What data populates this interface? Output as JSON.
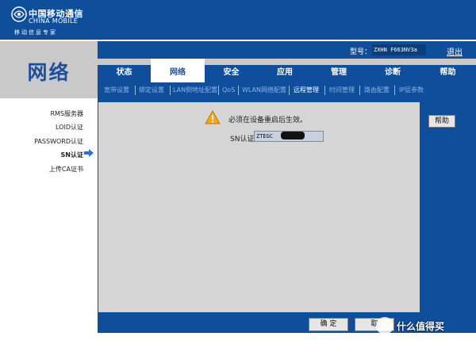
{
  "header": {
    "logo_cn": "中国移动通信",
    "logo_en": "CHINA MOBILE",
    "slogan": "移动信息专家"
  },
  "section_title": "网络",
  "model": {
    "label": "型号：",
    "value": "ZXHN F663NV3a"
  },
  "logout_label": "退出",
  "tabs": [
    {
      "label": "状态",
      "active": false
    },
    {
      "label": "网络",
      "active": true
    },
    {
      "label": "安全",
      "active": false
    },
    {
      "label": "应用",
      "active": false
    },
    {
      "label": "管理",
      "active": false
    },
    {
      "label": "诊断",
      "active": false
    },
    {
      "label": "帮助",
      "active": false
    }
  ],
  "subnav": [
    {
      "label": "宽带设置",
      "active": false
    },
    {
      "label": "绑定设置",
      "active": false
    },
    {
      "label": "LAN侧地址配置",
      "active": false
    },
    {
      "label": "QoS",
      "active": false
    },
    {
      "label": "WLAN网络配置",
      "active": false
    },
    {
      "label": "远程管理",
      "active": true
    },
    {
      "label": "时间管理",
      "active": false
    },
    {
      "label": "路由配置",
      "active": false
    },
    {
      "label": "IP层参数",
      "active": false
    }
  ],
  "leftmenu": [
    {
      "label": "RMS服务器",
      "active": false
    },
    {
      "label": "LOID认证",
      "active": false
    },
    {
      "label": "PASSWORD认证",
      "active": false
    },
    {
      "label": "SN认证",
      "active": true
    },
    {
      "label": "上传CA证书",
      "active": false
    }
  ],
  "content": {
    "warning": "必须在设备重启后生效。",
    "sn_label": "SN认证",
    "sn_value": "ZTEGC"
  },
  "buttons": {
    "help": "帮助",
    "confirm": "确 定",
    "cancel": "取"
  },
  "watermark": "什么值得买",
  "colors": {
    "primary_blue": "#0e4e9a",
    "panel_gray": "#d5d5d5",
    "title_blue": "#1f4f9a"
  }
}
